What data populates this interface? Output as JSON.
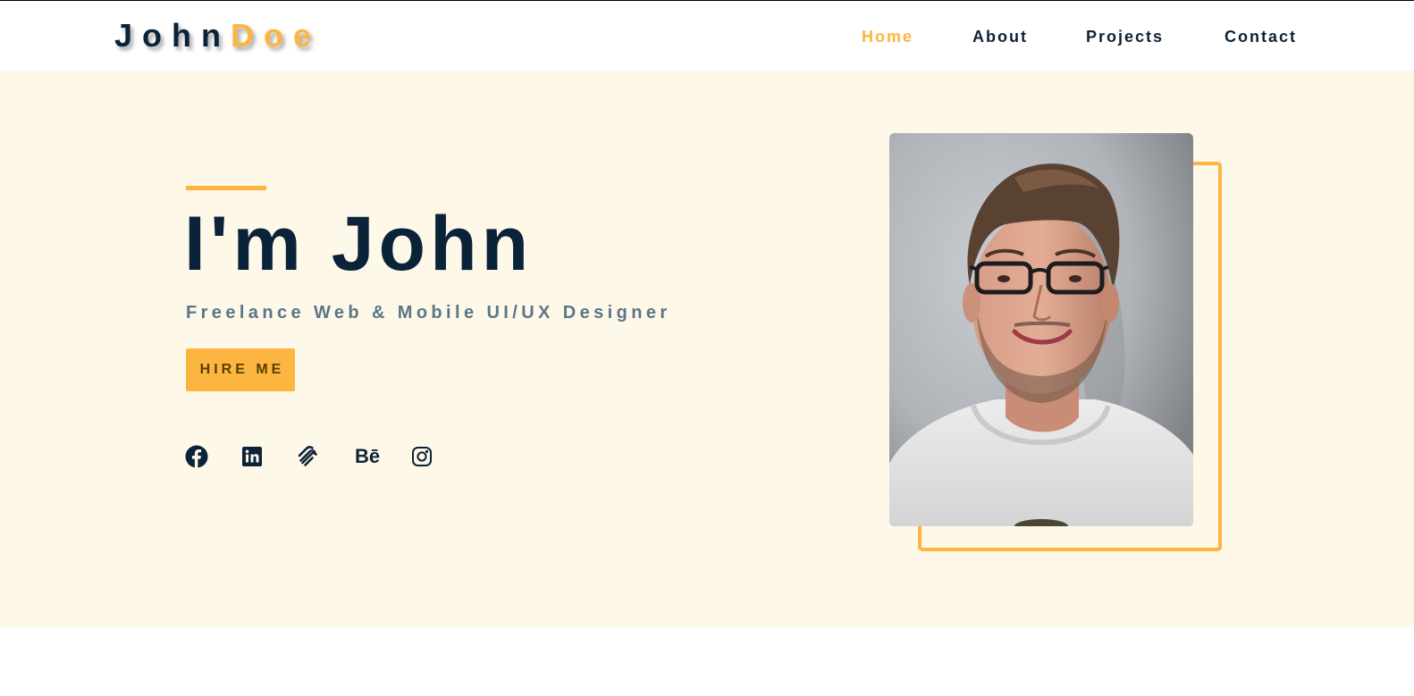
{
  "logo": {
    "part1": "John",
    "part2": "Doe"
  },
  "nav": {
    "items": [
      {
        "label": "Home",
        "active": true
      },
      {
        "label": "About",
        "active": false
      },
      {
        "label": "Projects",
        "active": false
      },
      {
        "label": "Contact",
        "active": false
      }
    ]
  },
  "hero": {
    "title": "I'm John",
    "subtitle": "Freelance Web & Mobile UI/UX Designer",
    "cta_label": "HIRE ME",
    "social": [
      {
        "icon": "facebook-icon"
      },
      {
        "icon": "linkedin-icon"
      },
      {
        "icon": "squarespace-icon"
      },
      {
        "icon": "behance-icon",
        "label": "Bē"
      },
      {
        "icon": "instagram-icon"
      }
    ]
  },
  "colors": {
    "accent": "#fbb540",
    "navy": "#0b2338",
    "hero_bg": "#fef8e9",
    "subtitle": "#5b7688"
  }
}
